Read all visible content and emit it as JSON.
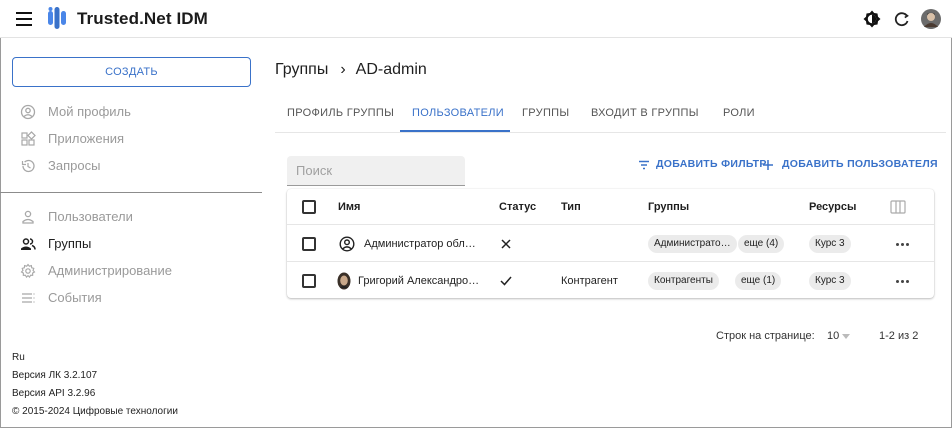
{
  "header": {
    "app_title": "Trusted.Net IDM",
    "icons": [
      "menu-icon",
      "trusted-logo-icon",
      "theme-toggle-icon",
      "refresh-icon",
      "user-avatar"
    ],
    "accent_color": "#3a72c9"
  },
  "sidebar": {
    "create_label": "СОЗДАТЬ",
    "items_top": [
      {
        "label": "Мой профиль",
        "icon": "account-circle-icon"
      },
      {
        "label": "Приложения",
        "icon": "apps-grid-icon"
      },
      {
        "label": "Запросы",
        "icon": "history-icon"
      }
    ],
    "items_bottom": [
      {
        "label": "Пользователи",
        "icon": "person-icon"
      },
      {
        "label": "Группы",
        "icon": "group-icon",
        "active": true
      },
      {
        "label": "Администрирование",
        "icon": "gear-icon"
      },
      {
        "label": "События",
        "icon": "list-icon"
      }
    ],
    "footer": {
      "lang": "Ru",
      "version_lk": "Версия ЛК 3.2.107",
      "version_api": "Версия API 3.2.96",
      "copyright": "© 2015-2024 Цифровые технологии"
    }
  },
  "main": {
    "breadcrumb": {
      "parent": "Группы",
      "separator": "›",
      "current": "AD-admin"
    },
    "tabs": [
      {
        "label": "ПРОФИЛЬ ГРУППЫ"
      },
      {
        "label": "ПОЛЬЗОВАТЕЛИ",
        "active": true
      },
      {
        "label": "ГРУППЫ"
      },
      {
        "label": "ВХОДИТ В ГРУППЫ"
      },
      {
        "label": "РОЛИ"
      }
    ],
    "search": {
      "placeholder": "Поиск"
    },
    "add_filter_label": "ДОБАВИТЬ ФИЛЬТР",
    "add_user_label": "ДОБАВИТЬ ПОЛЬЗОВАТЕЛЯ",
    "table": {
      "columns": [
        "Имя",
        "Статус",
        "Тип",
        "Группы",
        "Ресурсы"
      ],
      "rows": [
        {
          "name": "Администратор обл…",
          "avatar": "account-circle-icon",
          "status": "cross-icon",
          "type": "",
          "group_chip": "Администрато…",
          "group_more": "еще (4)",
          "resource": "Курс 3"
        },
        {
          "name": "Григорий Александро…",
          "avatar": "user-photo",
          "status": "check-icon",
          "type": "Контрагент",
          "group_chip": "Контрагенты",
          "group_more": "еще (1)",
          "resource": "Курс 3"
        }
      ]
    },
    "pagination": {
      "rows_per_page_label": "Строк на странице:",
      "rows_per_page_value": "10",
      "range": "1-2 из 2"
    }
  }
}
